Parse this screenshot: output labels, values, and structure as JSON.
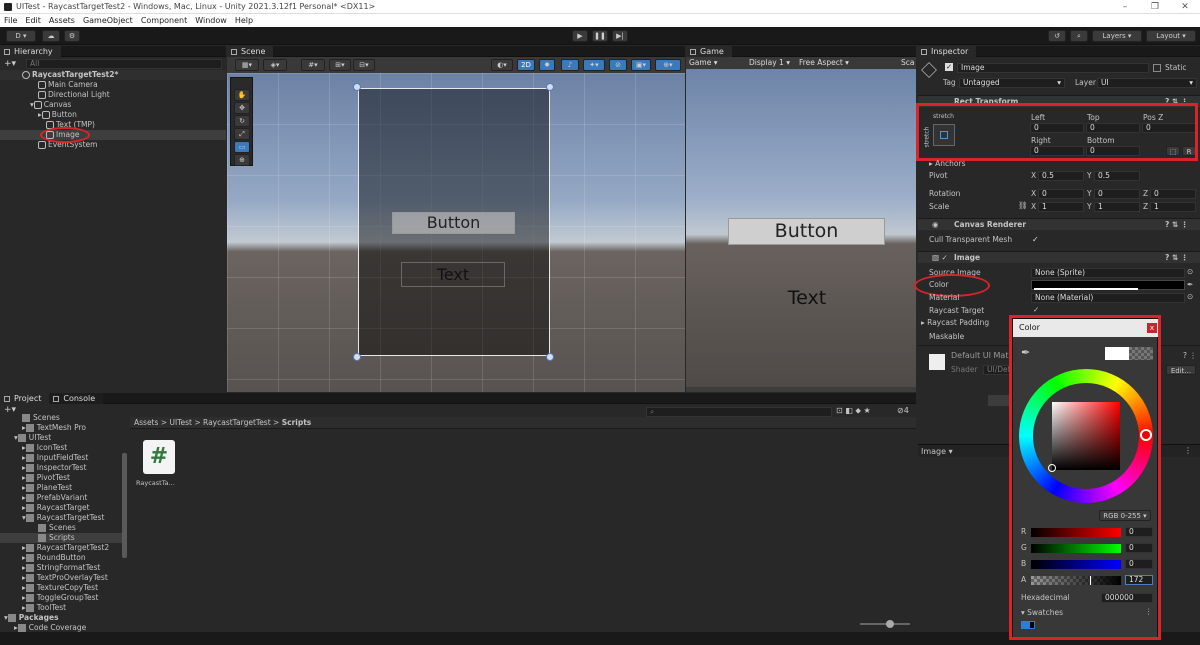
{
  "titlebar": {
    "title": "UITest - RaycastTargetTest2 - Windows, Mac, Linux - Unity 2021.3.12f1 Personal* <DX11>"
  },
  "menu": [
    "File",
    "Edit",
    "Assets",
    "GameObject",
    "Component",
    "Window",
    "Help"
  ],
  "toolbar": {
    "account": "D ▾",
    "layers": "Layers",
    "layout": "Layout"
  },
  "hierarchy": {
    "tab": "Hierarchy",
    "search_placeholder": "All",
    "items": [
      {
        "label": "RaycastTargetTest2*"
      },
      {
        "label": "Main Camera"
      },
      {
        "label": "Directional Light"
      },
      {
        "label": "Canvas"
      },
      {
        "label": "Button"
      },
      {
        "label": "Text (TMP)"
      },
      {
        "label": "Image"
      },
      {
        "label": "EventSystem"
      }
    ]
  },
  "scene": {
    "tab": "Scene",
    "mode_2d": "2D",
    "button_label": "Button",
    "text_label": "Text"
  },
  "game": {
    "tab": "Game",
    "display_menu": "Game",
    "display": "Display 1",
    "aspect": "Free Aspect",
    "scale_label": "Sca",
    "button_label": "Button",
    "text_label": "Text"
  },
  "inspector": {
    "tab": "Inspector",
    "object_name": "Image",
    "static_label": "Static",
    "tag_label": "Tag",
    "tag_value": "Untagged",
    "layer_label": "Layer",
    "layer_value": "UI",
    "rect_transform": {
      "title": "Rect Transform",
      "stretch_h": "stretch",
      "stretch_v": "stretch",
      "left_label": "Left",
      "left": "0",
      "top_label": "Top",
      "top": "0",
      "posz_label": "Pos Z",
      "posz": "0",
      "right_label": "Right",
      "right": "0",
      "bottom_label": "Bottom",
      "bottom": "0",
      "anchors_label": "Anchors",
      "pivot_label": "Pivot",
      "pivot_x": "0.5",
      "pivot_y": "0.5",
      "rotation_label": "Rotation",
      "rot_x": "0",
      "rot_y": "0",
      "rot_z": "0",
      "scale_label": "Scale",
      "scale_x": "1",
      "scale_y": "1",
      "scale_z": "1",
      "x": "X",
      "y": "Y",
      "z": "Z"
    },
    "canvas_renderer": {
      "title": "Canvas Renderer",
      "cull_label": "Cull Transparent Mesh"
    },
    "image": {
      "title": "Image",
      "source_label": "Source Image",
      "source_value": "None (Sprite)",
      "color_label": "Color",
      "material_label": "Material",
      "material_value": "None (Material)",
      "raycast_target_label": "Raycast Target",
      "raycast_padding_label": "Raycast Padding",
      "maskable_label": "Maskable"
    },
    "material": {
      "name": "Default UI Mat",
      "shader_label": "Shader",
      "shader_value": "UI/Defa",
      "edit": "Edit..."
    },
    "bottom_label": "Image ▾"
  },
  "color_picker": {
    "title": "Color",
    "close": "x",
    "mode": "RGB 0-255 ▾",
    "r_label": "R",
    "r": "0",
    "g_label": "G",
    "g": "0",
    "b_label": "B",
    "b": "0",
    "a_label": "A",
    "a": "172",
    "alpha_fraction": 0.674,
    "hex_label": "Hexadecimal",
    "hex": "000000",
    "swatches_label": "Swatches"
  },
  "project": {
    "tabs": [
      "Project",
      "Console"
    ],
    "tree": [
      {
        "label": "Scenes"
      },
      {
        "label": "TextMesh Pro"
      },
      {
        "label": "UITest"
      },
      {
        "label": "IconTest"
      },
      {
        "label": "InputFieldTest"
      },
      {
        "label": "InspectorTest"
      },
      {
        "label": "PivotTest"
      },
      {
        "label": "PlaneTest"
      },
      {
        "label": "PrefabVariant"
      },
      {
        "label": "RaycastTarget"
      },
      {
        "label": "RaycastTargetTest"
      },
      {
        "label": "Scenes"
      },
      {
        "label": "Scripts"
      },
      {
        "label": "RaycastTargetTest2"
      },
      {
        "label": "RoundButton"
      },
      {
        "label": "StringFormatTest"
      },
      {
        "label": "TextProOverlayTest"
      },
      {
        "label": "TextureCopyTest"
      },
      {
        "label": "ToggleGroupTest"
      },
      {
        "label": "ToolTest"
      },
      {
        "label": "Packages"
      },
      {
        "label": "Code Coverage"
      }
    ],
    "breadcrumb": [
      "Assets",
      "UITest",
      "RaycastTargetTest",
      "Scripts"
    ],
    "asset": {
      "glyph": "#",
      "label": "RaycastTa..."
    },
    "hidden_count": "4"
  },
  "colors": {
    "accent": "#3a79bb",
    "highlight_red": "#d9242a",
    "bg": "#282828"
  }
}
